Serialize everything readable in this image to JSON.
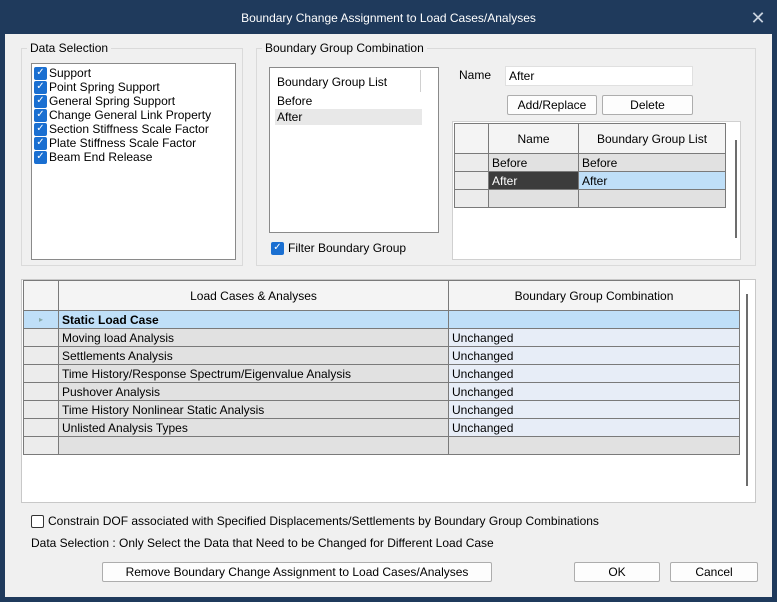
{
  "window": {
    "title": "Boundary Change Assignment to Load Cases/Analyses"
  },
  "data_selection": {
    "legend": "Data Selection",
    "items": [
      {
        "label": "Support",
        "checked": true
      },
      {
        "label": "Point Spring Support",
        "checked": true
      },
      {
        "label": "General Spring Support",
        "checked": true
      },
      {
        "label": "Change General Link Property",
        "checked": true
      },
      {
        "label": "Section Stiffness Scale Factor",
        "checked": true
      },
      {
        "label": "Plate Stiffness Scale Factor",
        "checked": true
      },
      {
        "label": "Beam End Release",
        "checked": true
      }
    ]
  },
  "bgc": {
    "legend": "Boundary Group Combination",
    "list_header": "Boundary Group List",
    "list_items": [
      "Before",
      "After"
    ],
    "selected_item": "After",
    "filter_label": "Filter Boundary Group",
    "filter_checked": true,
    "name_label": "Name",
    "name_value": "After",
    "add_replace_label": "Add/Replace",
    "delete_label": "Delete",
    "table": {
      "headers": [
        "Name",
        "Boundary Group List"
      ],
      "rows": [
        [
          "Before",
          "Before"
        ],
        [
          "After",
          "After"
        ],
        [
          "",
          ""
        ]
      ]
    }
  },
  "main_table": {
    "headers": [
      "Load Cases & Analyses",
      "Boundary Group Combination"
    ],
    "rows": [
      [
        "Static Load Case",
        ""
      ],
      [
        "Moving load Analysis",
        "Unchanged"
      ],
      [
        "Settlements Analysis",
        "Unchanged"
      ],
      [
        "Time History/Response Spectrum/Eigenvalue Analysis",
        "Unchanged"
      ],
      [
        "Pushover Analysis",
        "Unchanged"
      ],
      [
        "Time History Nonlinear Static Analysis",
        "Unchanged"
      ],
      [
        "Unlisted Analysis Types",
        "Unchanged"
      ],
      [
        "",
        ""
      ]
    ]
  },
  "constrain": {
    "label": "Constrain DOF associated with Specified Displacements/Settlements by Boundary Group Combinations",
    "checked": false
  },
  "note": "Data Selection : Only Select the Data that Need to be Changed for Different Load Case",
  "buttons": {
    "remove": "Remove Boundary Change Assignment to Load Cases/Analyses",
    "ok": "OK",
    "cancel": "Cancel"
  },
  "colors": {
    "titlebar": "#1f3a5c",
    "checkbox": "#1a6fd1",
    "selected_row": "#bfdff8",
    "dark_selection": "#3c3c3c"
  }
}
